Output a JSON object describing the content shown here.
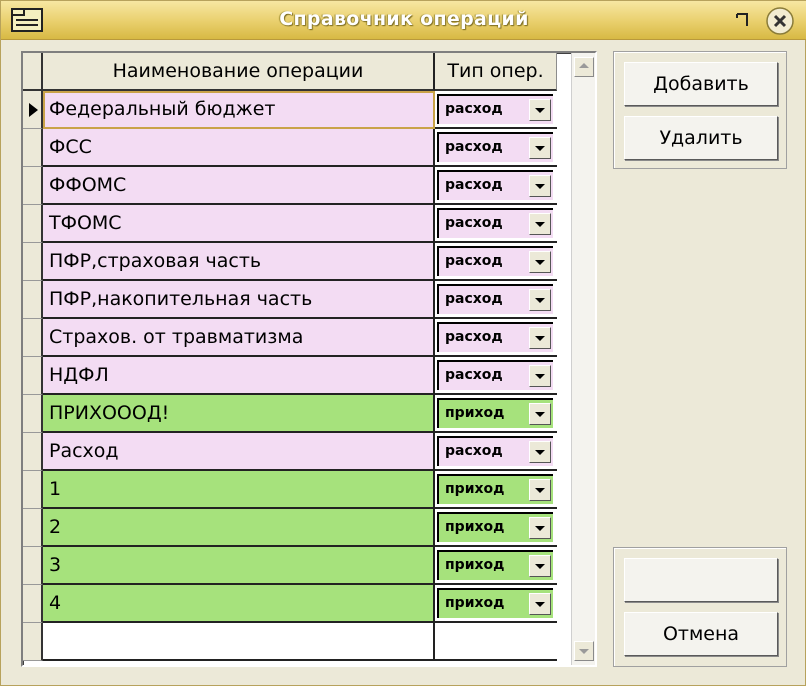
{
  "window": {
    "title": "Справочник операций",
    "colors": {
      "titlebar": "#e9cf6c",
      "pink_row": "#f3dcf3",
      "green_row": "#a6e27c"
    }
  },
  "grid": {
    "columns": [
      "Наименование операции",
      "Тип опер."
    ],
    "current_row": 0,
    "rows": [
      {
        "name": "Федеральный бюджет",
        "type": "расход",
        "color": "pink"
      },
      {
        "name": "ФСС",
        "type": "расход",
        "color": "pink"
      },
      {
        "name": "ФФОМС",
        "type": "расход",
        "color": "pink"
      },
      {
        "name": "ТФОМС",
        "type": "расход",
        "color": "pink"
      },
      {
        "name": "ПФР,страховая часть",
        "type": "расход",
        "color": "pink"
      },
      {
        "name": "ПФР,накопительная часть",
        "type": "расход",
        "color": "pink"
      },
      {
        "name": "Страхов. от травматизма",
        "type": "расход",
        "color": "pink"
      },
      {
        "name": "НДФЛ",
        "type": "расход",
        "color": "pink"
      },
      {
        "name": "ПРИХОООД!",
        "type": "приход",
        "color": "green"
      },
      {
        "name": "Расход",
        "type": "расход",
        "color": "pink"
      },
      {
        "name": "1",
        "type": "приход",
        "color": "green"
      },
      {
        "name": "2",
        "type": "приход",
        "color": "green"
      },
      {
        "name": "3",
        "type": "приход",
        "color": "green"
      },
      {
        "name": "4",
        "type": "приход",
        "color": "green"
      }
    ]
  },
  "buttons": {
    "add": "Добавить",
    "delete": "Удалить",
    "save": "",
    "cancel": "Отмена"
  }
}
